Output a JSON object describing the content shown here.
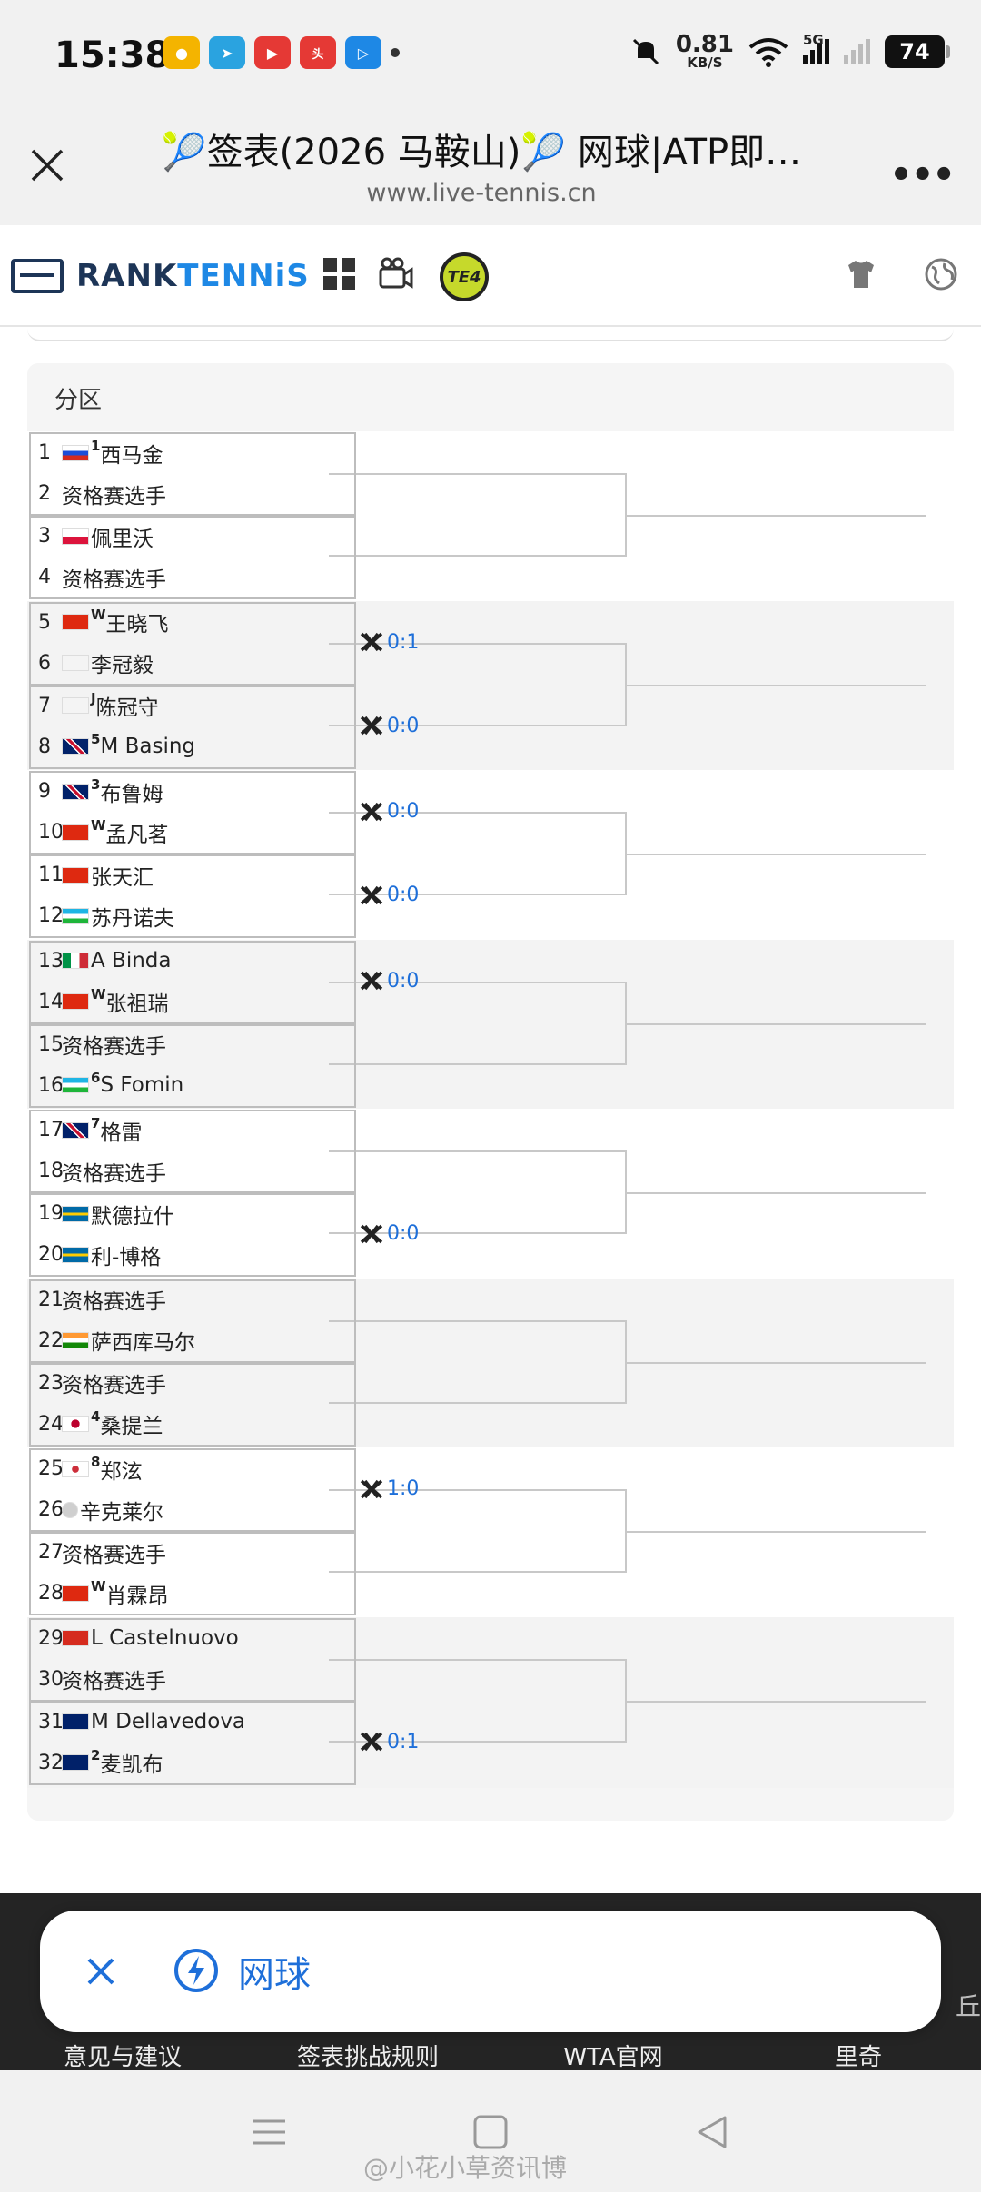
{
  "status_bar": {
    "time": "15:38",
    "net_speed_value": "0.81",
    "net_speed_unit": "KB/S",
    "signal_label": "5G",
    "battery": "74"
  },
  "browser": {
    "title": "🎾签表(2026 马鞍山)🎾 网球|ATP即…",
    "url": "www.live-tennis.cn"
  },
  "site_nav": {
    "logo_part1": "RANK",
    "logo_part2": "TENNiS",
    "te4_label": "TE4"
  },
  "draw": {
    "section_label": "分区",
    "players": [
      {
        "num": "1",
        "flag": "ru",
        "seed": "1",
        "name": "西马金"
      },
      {
        "num": "2",
        "flag": "",
        "seed": "",
        "name": "资格赛选手"
      },
      {
        "num": "3",
        "flag": "pl",
        "seed": "",
        "name": "佩里沃"
      },
      {
        "num": "4",
        "flag": "",
        "seed": "",
        "name": "资格赛选手"
      },
      {
        "num": "5",
        "flag": "cn",
        "seed": "W",
        "name": "王晓飞"
      },
      {
        "num": "6",
        "flag": "tw",
        "seed": "",
        "name": "李冠毅"
      },
      {
        "num": "7",
        "flag": "tw",
        "seed": "J",
        "name": "陈冠守"
      },
      {
        "num": "8",
        "flag": "gb",
        "seed": "5",
        "name": "M Basing"
      },
      {
        "num": "9",
        "flag": "gb",
        "seed": "3",
        "name": "布鲁姆"
      },
      {
        "num": "10",
        "flag": "cn",
        "seed": "W",
        "name": "孟凡茗"
      },
      {
        "num": "11",
        "flag": "cn",
        "seed": "",
        "name": "张天汇"
      },
      {
        "num": "12",
        "flag": "uz",
        "seed": "",
        "name": "苏丹诺夫"
      },
      {
        "num": "13",
        "flag": "it",
        "seed": "",
        "name": "A Binda"
      },
      {
        "num": "14",
        "flag": "cn",
        "seed": "W",
        "name": "张祖瑞"
      },
      {
        "num": "15",
        "flag": "",
        "seed": "",
        "name": "资格赛选手"
      },
      {
        "num": "16",
        "flag": "uz",
        "seed": "6",
        "name": "S Fomin"
      },
      {
        "num": "17",
        "flag": "gb",
        "seed": "7",
        "name": "格雷"
      },
      {
        "num": "18",
        "flag": "",
        "seed": "",
        "name": "资格赛选手"
      },
      {
        "num": "19",
        "flag": "se",
        "seed": "",
        "name": "默德拉什"
      },
      {
        "num": "20",
        "flag": "se",
        "seed": "",
        "name": "利-博格"
      },
      {
        "num": "21",
        "flag": "",
        "seed": "",
        "name": "资格赛选手"
      },
      {
        "num": "22",
        "flag": "in",
        "seed": "",
        "name": "萨西库马尔"
      },
      {
        "num": "23",
        "flag": "",
        "seed": "",
        "name": "资格赛选手"
      },
      {
        "num": "24",
        "flag": "jp",
        "seed": "4",
        "name": "桑提兰"
      },
      {
        "num": "25",
        "flag": "kr",
        "seed": "8",
        "name": "郑泫"
      },
      {
        "num": "26",
        "flag": "none",
        "seed": "",
        "name": "辛克莱尔"
      },
      {
        "num": "27",
        "flag": "",
        "seed": "",
        "name": "资格赛选手"
      },
      {
        "num": "28",
        "flag": "cn",
        "seed": "W",
        "name": "肖霖昂"
      },
      {
        "num": "29",
        "flag": "ch",
        "seed": "",
        "name": "L Castelnuovo"
      },
      {
        "num": "30",
        "flag": "",
        "seed": "",
        "name": "资格赛选手"
      },
      {
        "num": "31",
        "flag": "au",
        "seed": "",
        "name": "M Dellavedova"
      },
      {
        "num": "32",
        "flag": "au",
        "seed": "2",
        "name": "麦凯布"
      }
    ],
    "h2h": [
      {
        "pair": 2,
        "score": "0:1"
      },
      {
        "pair": 3,
        "score": "0:0"
      },
      {
        "pair": 4,
        "score": "0:0"
      },
      {
        "pair": 5,
        "score": "0:0"
      },
      {
        "pair": 6,
        "score": "0:0"
      },
      {
        "pair": 9,
        "score": "0:0"
      },
      {
        "pair": 12,
        "score": "1:0"
      },
      {
        "pair": 15,
        "score": "0:1"
      }
    ]
  },
  "footer": {
    "links": [
      "意见与建议",
      "签表挑战规则",
      "WTA官网",
      "里奇"
    ],
    "edge_text": "丘"
  },
  "toast": {
    "label": "网球"
  },
  "watermark": "@小花小草资讯博",
  "colors": {
    "accent": "#1e6fd9",
    "logo_dark": "#1d3557",
    "footer_bg": "#242424"
  }
}
